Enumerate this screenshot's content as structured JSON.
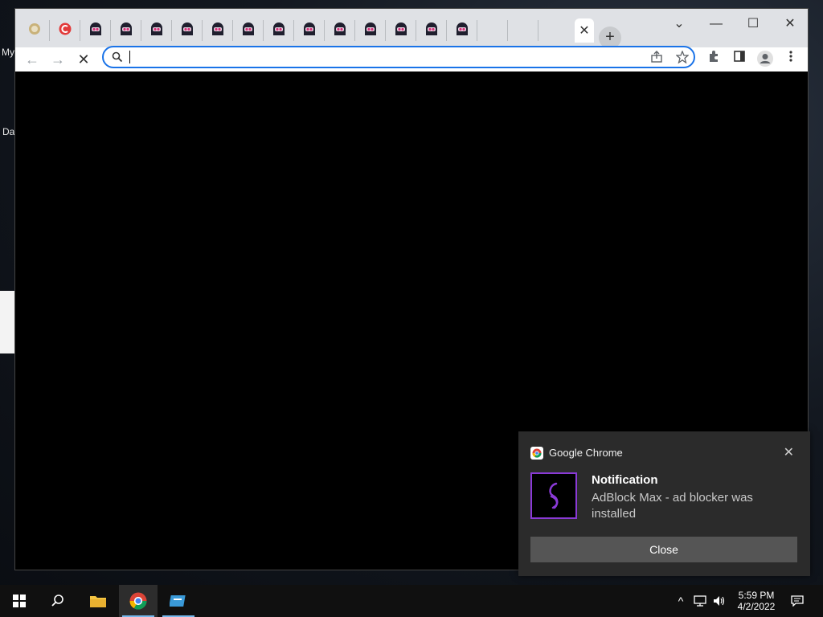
{
  "desktop": {
    "icon_label_1": "My",
    "icon_label_2": "Da"
  },
  "browser": {
    "tabs": [
      {
        "icon": "generic-globe-icon"
      },
      {
        "icon": "red-c-icon"
      },
      {
        "icon": "hacker-hood-icon"
      },
      {
        "icon": "hacker-hood-icon"
      },
      {
        "icon": "hacker-hood-icon"
      },
      {
        "icon": "hacker-hood-icon"
      },
      {
        "icon": "hacker-hood-icon"
      },
      {
        "icon": "hacker-hood-icon"
      },
      {
        "icon": "hacker-hood-icon"
      },
      {
        "icon": "hacker-hood-icon"
      },
      {
        "icon": "hacker-hood-icon"
      },
      {
        "icon": "hacker-hood-icon"
      },
      {
        "icon": "hacker-hood-icon"
      },
      {
        "icon": "hacker-hood-icon"
      },
      {
        "icon": "hacker-hood-icon"
      },
      {
        "icon": "blank"
      },
      {
        "icon": "blank"
      }
    ],
    "active_tab_close": "✕",
    "new_tab": "+",
    "window_controls": {
      "minimize": "—",
      "maximize": "☐",
      "close": "✕",
      "tab_search": "⌄"
    },
    "address_bar_value": "",
    "nav": {
      "back": "←",
      "forward": "→",
      "stop": "✕"
    }
  },
  "notification": {
    "app_name": "Google Chrome",
    "title": "Notification",
    "body": "AdBlock Max - ad blocker was installed",
    "button": "Close",
    "close_glyph": "✕",
    "accent_color": "#8a3ad6"
  },
  "taskbar": {
    "time": "5:59 PM",
    "date": "4/2/2022"
  }
}
